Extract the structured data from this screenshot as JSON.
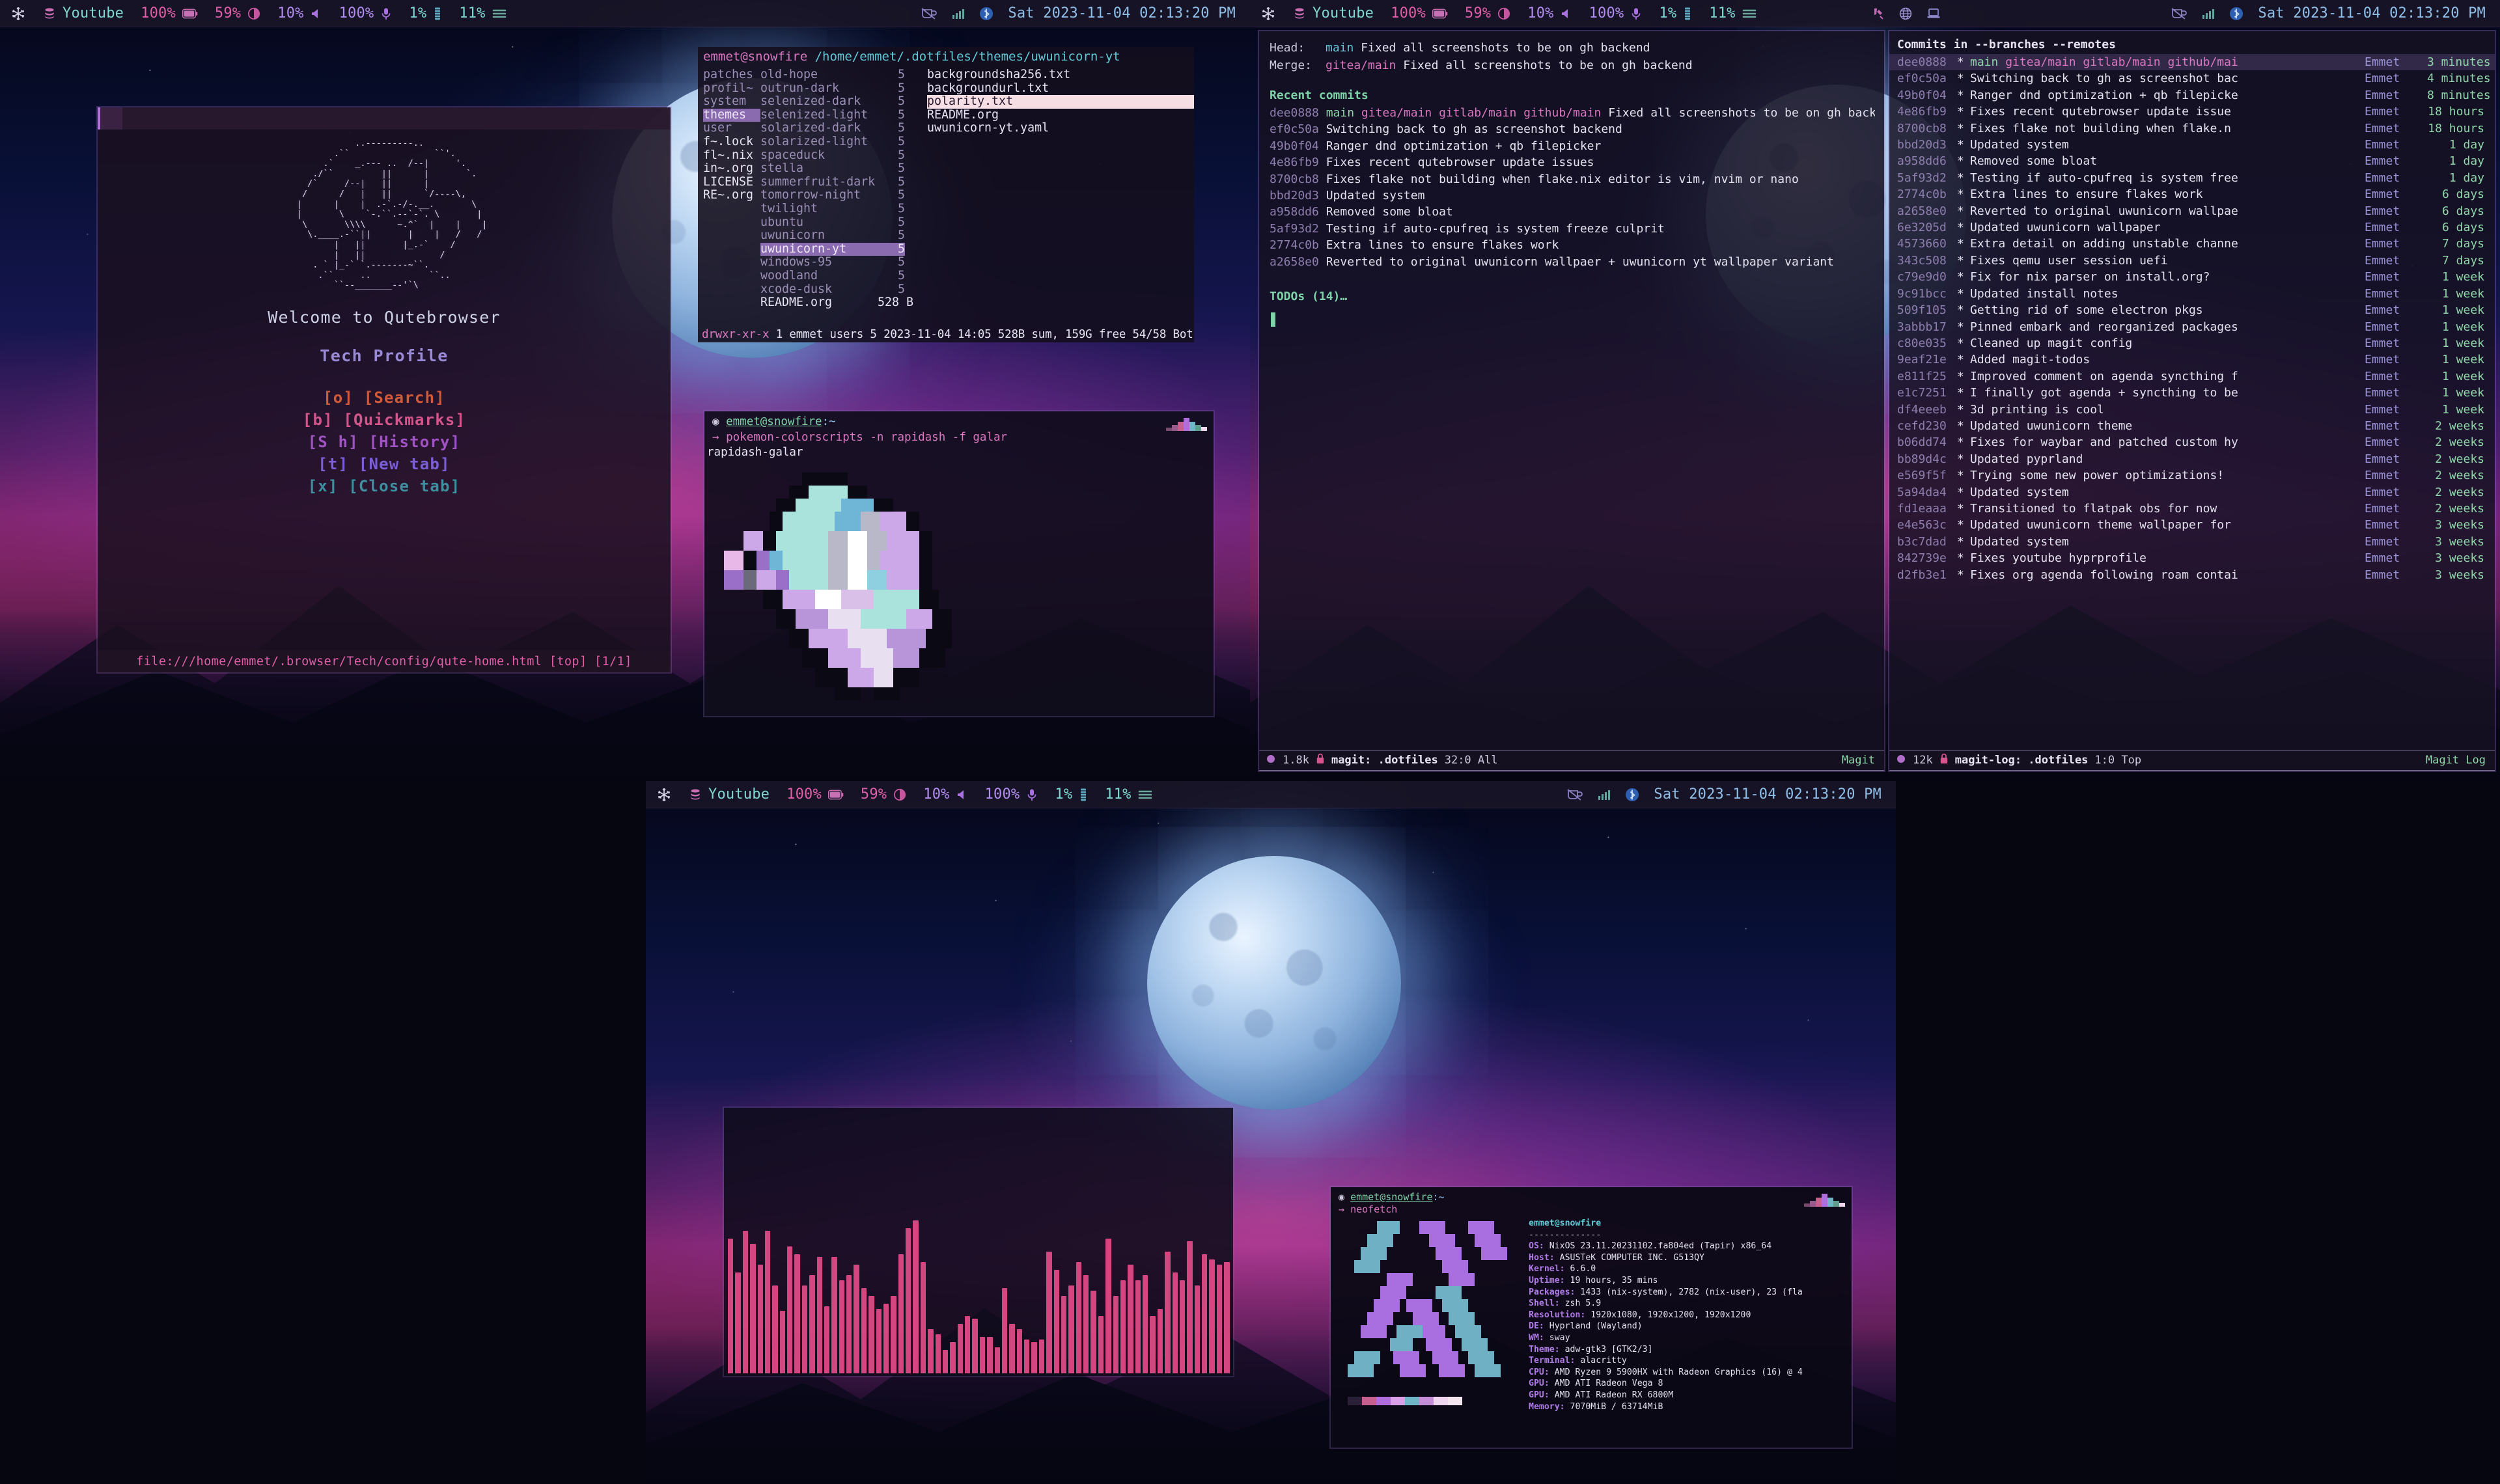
{
  "bar": {
    "left": [
      {
        "icon": "nix-snowflake-icon",
        "label": ""
      },
      {
        "icon": "layers-icon",
        "label": "Youtube"
      },
      {
        "label": "100%",
        "icon": "battery-icon"
      },
      {
        "label": "59%",
        "icon": "brightness-icon"
      },
      {
        "label": "10%",
        "icon": "volume-icon"
      },
      {
        "label": "100%",
        "icon": "microphone-icon"
      },
      {
        "label": "1%",
        "icon": "cpu-icon"
      },
      {
        "label": "11%",
        "icon": "memory-icon"
      }
    ],
    "tray": [
      "pen-icon",
      "globe-icon",
      "laptop-icon"
    ],
    "right": [
      "no-coffee-icon",
      "wifi-icon",
      "bluetooth-icon"
    ],
    "clock": "Sat 2023-11-04 02:13:20 PM"
  },
  "qutebrowser": {
    "ascii_logo": "              ..---------..\n          .``                ``'.\n        .`    _.--- ..  /--|     '.\n      ./``         ||      |       `.\n     /`     /--|   ||      |\n    /      /   |   ||      `/----\\,\n   |      |    |  .-`.-/-.__.       \\\n   |       \\    `-.``.--`-`. \\       |\n    \\       \\\\\\\\      ~.^`  |    |    |\n     \\.____.-``||       |    |   /   /\n          |   ||       |_.-`    /\n          |   ||              /\n      . ` |_-` `.-------~``.\n       .``     ..           ``..\n          ``--_______--'`\\",
    "welcome": "Welcome to Qutebrowser",
    "profile": "Tech Profile",
    "links": [
      {
        "key": "[o]",
        "label": "[Search]",
        "color": "#d15a3a"
      },
      {
        "key": "[b]",
        "label": "[Quickmarks]",
        "color": "#d4558c"
      },
      {
        "key": "[S h]",
        "label": "[History]",
        "color": "#a054c4"
      },
      {
        "key": "[t]",
        "label": "[New tab]",
        "color": "#7b5fd6"
      },
      {
        "key": "[x]",
        "label": "[Close tab]",
        "color": "#3f8fa0"
      }
    ],
    "statusline": "file:///home/emmet/.browser/Tech/config/qute-home.html [top] [1/1]"
  },
  "ranger": {
    "prompt_user": "emmet@snowfire",
    "path": "/home/emmet/.dotfiles/themes/uwunicorn-yt",
    "col1": [
      {
        "name": "patches",
        "dim": true
      },
      {
        "name": "profil~",
        "dim": true
      },
      {
        "name": "system",
        "dim": true
      },
      {
        "name": "themes",
        "dim": false,
        "selected": "purple"
      },
      {
        "name": "user",
        "dim": true
      },
      {
        "name": "f~.lock",
        "dim": false
      },
      {
        "name": "fl~.nix",
        "dim": false
      },
      {
        "name": "in~.org",
        "dim": false
      },
      {
        "name": "LICENSE",
        "dim": false
      },
      {
        "name": "RE~.org",
        "dim": false
      }
    ],
    "col2": [
      {
        "name": "old-hope",
        "size": "5"
      },
      {
        "name": "outrun-dark",
        "size": "5"
      },
      {
        "name": "selenized-dark",
        "size": "5"
      },
      {
        "name": "selenized-light",
        "size": "5"
      },
      {
        "name": "solarized-dark",
        "size": "5"
      },
      {
        "name": "solarized-light",
        "size": "5"
      },
      {
        "name": "spaceduck",
        "size": "5"
      },
      {
        "name": "stella",
        "size": "5"
      },
      {
        "name": "summerfruit-dark",
        "size": "5"
      },
      {
        "name": "tomorrow-night",
        "size": "5"
      },
      {
        "name": "twilight",
        "size": "5"
      },
      {
        "name": "ubuntu",
        "size": "5"
      },
      {
        "name": "uwunicorn",
        "size": "5"
      },
      {
        "name": "uwunicorn-yt",
        "size": "5",
        "selected": "purple"
      },
      {
        "name": "windows-95",
        "size": "5"
      },
      {
        "name": "woodland",
        "size": "5"
      },
      {
        "name": "xcode-dusk",
        "size": "5"
      },
      {
        "name": "README.org",
        "size": "528 B",
        "bright": true
      }
    ],
    "col3": [
      {
        "name": "backgroundsha256.txt"
      },
      {
        "name": "backgroundurl.txt"
      },
      {
        "name": "polarity.txt",
        "selected": "pink"
      },
      {
        "name": "README.org"
      },
      {
        "name": "uwunicorn-yt.yaml"
      }
    ],
    "footer_perms": "drwxr-xr-x",
    "footer_rest": "1 emmet users 5 2023-11-04 14:05 528B sum, 159G free  54/58  Bot"
  },
  "pokemon": {
    "prompt": "emmet@snowfire",
    "prompt_path": ":~",
    "command": "pokemon-colorscripts -n rapidash -f galar",
    "output": "rapidash-galar"
  },
  "magit": {
    "head_key": "Head:",
    "head_branch": "main",
    "head_msg": "Fixed all screenshots to be on gh backend",
    "merge_key": "Merge:",
    "merge_branch": "gitea/main",
    "merge_msg": "Fixed all screenshots to be on gh backend",
    "section": "Recent commits",
    "commits": [
      {
        "sha": "dee0888",
        "refs": [
          "main",
          "gitea/main",
          "gitlab/main",
          "github/main"
        ],
        "msg": "Fixed all screenshots to be on gh backend"
      },
      {
        "sha": "ef0c50a",
        "refs": [],
        "msg": "Switching back to gh as screenshot backend"
      },
      {
        "sha": "49b0f04",
        "refs": [],
        "msg": "Ranger dnd optimization + qb filepicker"
      },
      {
        "sha": "4e86fb9",
        "refs": [],
        "msg": "Fixes recent qutebrowser update issues"
      },
      {
        "sha": "8700cb8",
        "refs": [],
        "msg": "Fixes flake not building when flake.nix editor is vim, nvim or nano"
      },
      {
        "sha": "bbd20d3",
        "refs": [],
        "msg": "Updated system"
      },
      {
        "sha": "a958dd6",
        "refs": [],
        "msg": "Removed some bloat"
      },
      {
        "sha": "5af93d2",
        "refs": [],
        "msg": "Testing if auto-cpufreq is system freeze culprit"
      },
      {
        "sha": "2774c0b",
        "refs": [],
        "msg": "Extra lines to ensure flakes work"
      },
      {
        "sha": "a2658e0",
        "refs": [],
        "msg": "Reverted to original uwunicorn wallpaer + uwunicorn yt wallpaper variant"
      }
    ],
    "todos": "TODOs (14)…",
    "modeline": {
      "size": "1.8k",
      "buffer": "magit: .dotfiles",
      "pos": "32:0 All",
      "mode": "Magit",
      "lock_icon": "lock-icon",
      "circle_icon": "circle-icon"
    }
  },
  "magitlog": {
    "header": "Commits in --branches --remotes",
    "rows": [
      {
        "sha": "dee0888",
        "msg": "main gitea/main gitlab/main github/mai",
        "author": "Emmet",
        "age": "3 minutes",
        "active": true,
        "refs": true
      },
      {
        "sha": "ef0c50a",
        "msg": "Switching back to gh as screenshot bac",
        "author": "Emmet",
        "age": "4 minutes"
      },
      {
        "sha": "49b0f04",
        "msg": "Ranger dnd optimization + qb filepicke",
        "author": "Emmet",
        "age": "8 minutes"
      },
      {
        "sha": "4e86fb9",
        "msg": "Fixes recent qutebrowser update issue",
        "author": "Emmet",
        "age": "18 hours"
      },
      {
        "sha": "8700cb8",
        "msg": "Fixes flake not building when flake.n",
        "author": "Emmet",
        "age": "18 hours"
      },
      {
        "sha": "bbd20d3",
        "msg": "Updated system",
        "author": "Emmet",
        "age": "1 day"
      },
      {
        "sha": "a958dd6",
        "msg": "Removed some bloat",
        "author": "Emmet",
        "age": "1 day"
      },
      {
        "sha": "5af93d2",
        "msg": "Testing if auto-cpufreq is system free",
        "author": "Emmet",
        "age": "1 day"
      },
      {
        "sha": "2774c0b",
        "msg": "Extra lines to ensure flakes work",
        "author": "Emmet",
        "age": "6 days"
      },
      {
        "sha": "a2658e0",
        "msg": "Reverted to original uwunicorn wallpae",
        "author": "Emmet",
        "age": "6 days"
      },
      {
        "sha": "6e3205d",
        "msg": "Updated uwunicorn wallpaper",
        "author": "Emmet",
        "age": "6 days"
      },
      {
        "sha": "4573660",
        "msg": "Extra detail on adding unstable channe",
        "author": "Emmet",
        "age": "7 days"
      },
      {
        "sha": "343c508",
        "msg": "Fixes qemu user session uefi",
        "author": "Emmet",
        "age": "7 days"
      },
      {
        "sha": "c79e9d0",
        "msg": "Fix for nix parser on install.org?",
        "author": "Emmet",
        "age": "1 week"
      },
      {
        "sha": "9c91bcc",
        "msg": "Updated install notes",
        "author": "Emmet",
        "age": "1 week"
      },
      {
        "sha": "509f105",
        "msg": "Getting rid of some electron pkgs",
        "author": "Emmet",
        "age": "1 week"
      },
      {
        "sha": "3abbb17",
        "msg": "Pinned embark and reorganized packages",
        "author": "Emmet",
        "age": "1 week"
      },
      {
        "sha": "c80e035",
        "msg": "Cleaned up magit config",
        "author": "Emmet",
        "age": "1 week"
      },
      {
        "sha": "9eaf21e",
        "msg": "Added magit-todos",
        "author": "Emmet",
        "age": "1 week"
      },
      {
        "sha": "e811f25",
        "msg": "Improved comment on agenda syncthing f",
        "author": "Emmet",
        "age": "1 week"
      },
      {
        "sha": "e1c7251",
        "msg": "I finally got agenda + syncthing to be",
        "author": "Emmet",
        "age": "1 week"
      },
      {
        "sha": "df4eeeb",
        "msg": "3d printing is cool",
        "author": "Emmet",
        "age": "1 week"
      },
      {
        "sha": "cefd230",
        "msg": "Updated uwunicorn theme",
        "author": "Emmet",
        "age": "2 weeks"
      },
      {
        "sha": "b06dd74",
        "msg": "Fixes for waybar and patched custom hy",
        "author": "Emmet",
        "age": "2 weeks"
      },
      {
        "sha": "bb89d4c",
        "msg": "Updated pyprland",
        "author": "Emmet",
        "age": "2 weeks"
      },
      {
        "sha": "e569f5f",
        "msg": "Trying some new power optimizations!",
        "author": "Emmet",
        "age": "2 weeks"
      },
      {
        "sha": "5a94da4",
        "msg": "Updated system",
        "author": "Emmet",
        "age": "2 weeks"
      },
      {
        "sha": "fd1eaaa",
        "msg": "Transitioned to flatpak obs for now",
        "author": "Emmet",
        "age": "2 weeks"
      },
      {
        "sha": "e4e563c",
        "msg": "Updated uwunicorn theme wallpaper for",
        "author": "Emmet",
        "age": "3 weeks"
      },
      {
        "sha": "b3c7dad",
        "msg": "Updated system",
        "author": "Emmet",
        "age": "3 weeks"
      },
      {
        "sha": "842739e",
        "msg": "Fixes youtube hyprprofile",
        "author": "Emmet",
        "age": "3 weeks"
      },
      {
        "sha": "d2fb3e1",
        "msg": "Fixes org agenda following roam contai",
        "author": "Emmet",
        "age": "3 weeks"
      }
    ],
    "modeline": {
      "size": "12k",
      "buffer": "magit-log: .dotfiles",
      "pos": "1:0 Top",
      "mode": "Magit Log",
      "lock_icon": "lock-icon",
      "circle_icon": "circle-icon"
    }
  },
  "neofetch": {
    "prompt": "emmet@snowfire",
    "prompt_path": ":~",
    "command": "neofetch",
    "title": "emmet@snowfire",
    "divider": "--------------",
    "info": [
      {
        "k": "OS",
        "v": "NixOS 23.11.20231102.fa804ed (Tapir) x86_64"
      },
      {
        "k": "Host",
        "v": "ASUSTeK COMPUTER INC. G513QY"
      },
      {
        "k": "Kernel",
        "v": "6.6.0"
      },
      {
        "k": "Uptime",
        "v": "19 hours, 35 mins"
      },
      {
        "k": "Packages",
        "v": "1433 (nix-system), 2782 (nix-user), 23 (fla"
      },
      {
        "k": "Shell",
        "v": "zsh 5.9"
      },
      {
        "k": "Resolution",
        "v": "1920x1080, 1920x1200, 1920x1200"
      },
      {
        "k": "DE",
        "v": "Hyprland (Wayland)"
      },
      {
        "k": "WM",
        "v": "sway"
      },
      {
        "k": "Theme",
        "v": "adw-gtk3 [GTK2/3]"
      },
      {
        "k": "Terminal",
        "v": "alacritty"
      },
      {
        "k": "CPU",
        "v": "AMD Ryzen 9 5900HX with Radeon Graphics (16) @ 4"
      },
      {
        "k": "GPU",
        "v": "AMD ATI Radeon Vega 8"
      },
      {
        "k": "GPU",
        "v": "AMD ATI Radeon RX 6800M"
      },
      {
        "k": "Memory",
        "v": "7070MiB / 63714MiB"
      }
    ],
    "palette": [
      "#2a2139",
      "#c75f8f",
      "#b06de0",
      "#d9a0e8",
      "#6fb6c6",
      "#c48fd6",
      "#efd6ef",
      "#f3e6ef"
    ]
  },
  "cava": {
    "color": "#d4467f",
    "bars": [
      52,
      39,
      55,
      50,
      42,
      55,
      34,
      24,
      49,
      46,
      34,
      38,
      45,
      26,
      45,
      36,
      38,
      42,
      33,
      30,
      25,
      27,
      30,
      46,
      56,
      59,
      43,
      17,
      15,
      9,
      12,
      19,
      22,
      21,
      14,
      14,
      10,
      33,
      19,
      17,
      13,
      12,
      13,
      47,
      40,
      30,
      34,
      43,
      38,
      32,
      22,
      52,
      30,
      36,
      42,
      36,
      38,
      22,
      25,
      47,
      39,
      36,
      51,
      34,
      46,
      44,
      42,
      43
    ]
  },
  "swatches": [
    "#7b4a6e",
    "#9a5a8c",
    "#c75f8f",
    "#b06de0",
    "#6fb6c6",
    "#5f9e8f",
    "#efd6ef"
  ]
}
